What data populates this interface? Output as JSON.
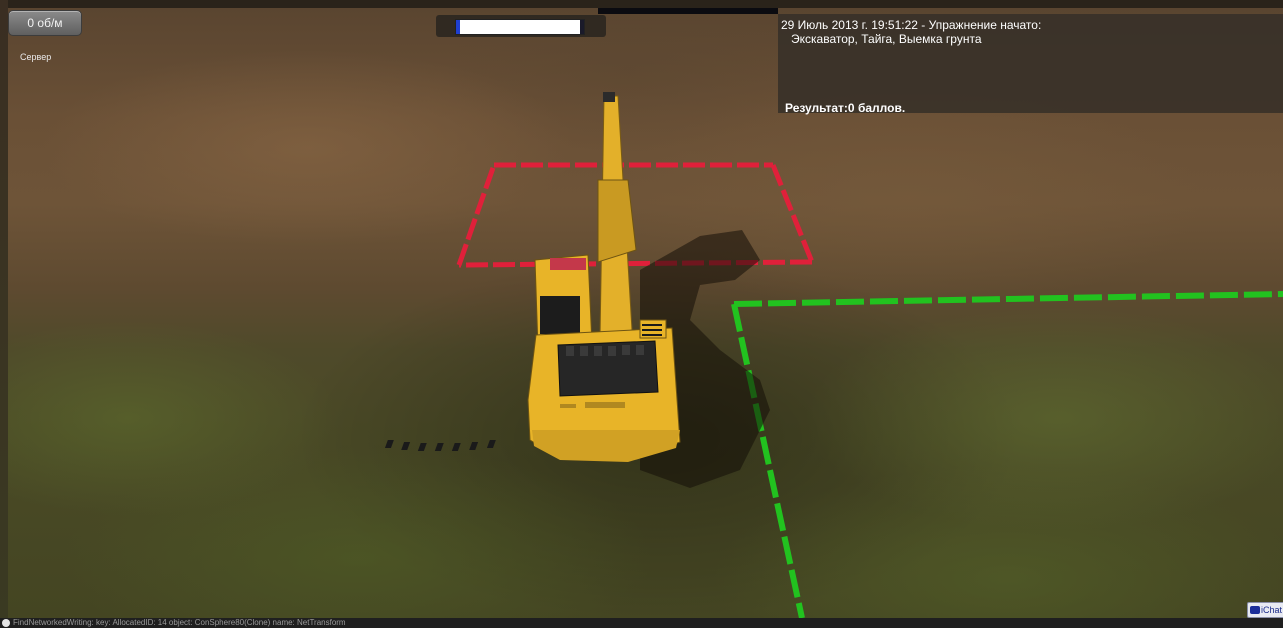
{
  "hud": {
    "speed_label": "0 об/м",
    "server_label": "Сервер",
    "progress": 0.97
  },
  "event_log": {
    "line1": "29 Июль 2013 г. 19:51:22 - Упражнение начато:",
    "line2": "Экскаватор, Тайга, Выемка грунта",
    "result": "Результат:0 баллов."
  },
  "chat_button": {
    "label": "iChat"
  },
  "status_bar": {
    "text": "FindNetworkedWriting: key: AllocatedID: 14 object: ConSphere80(Clone) name: NetTransform"
  },
  "colors": {
    "red_zone": "#e0203a",
    "green_zone": "#22c21f",
    "excavator_yellow": "#e8b428",
    "panel_bg": "#37302a"
  },
  "icons": [
    "chat-icon",
    "info-icon"
  ]
}
